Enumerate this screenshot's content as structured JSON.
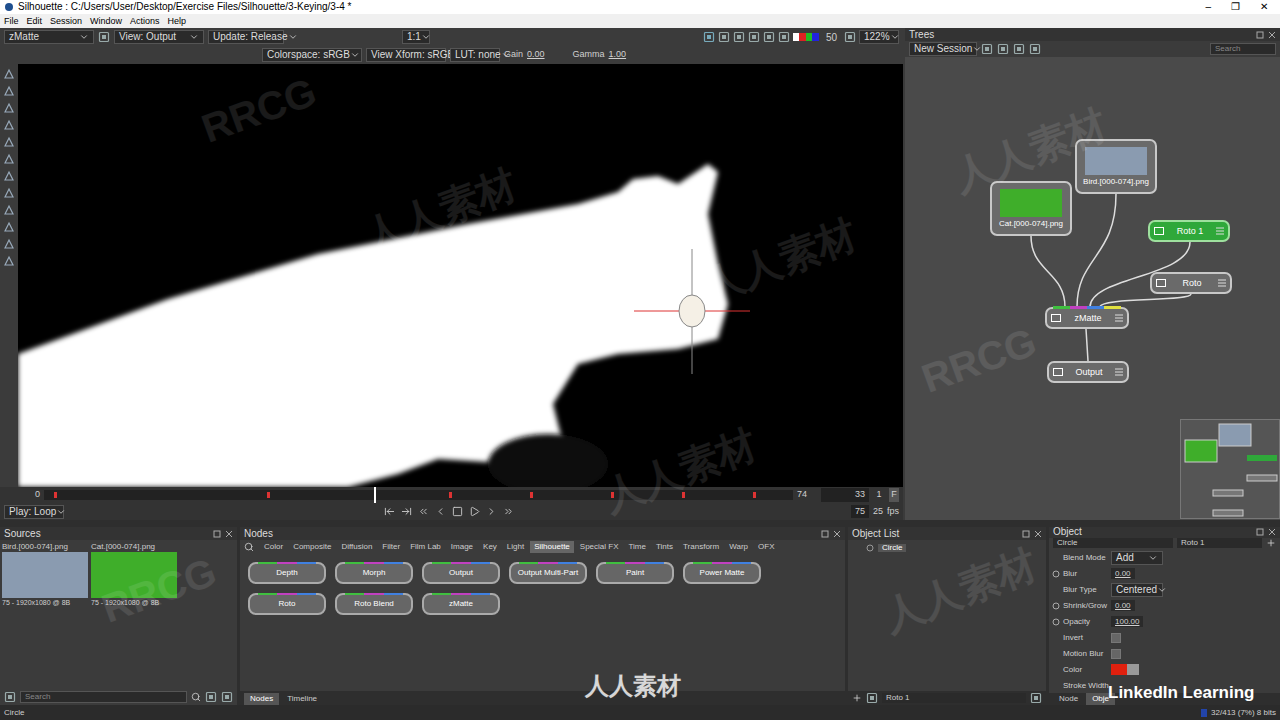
{
  "window": {
    "title": "Silhouette : C:/Users/User/Desktop/Exercise Files/Silhouette/3-Keying/3-4 *",
    "controls": [
      "–",
      "❐",
      "✕"
    ]
  },
  "menu": [
    "File",
    "Edit",
    "Session",
    "Window",
    "Actions",
    "Help"
  ],
  "viewer_toolbar": {
    "node": "zMatte",
    "view": "View: Output",
    "update": "Update: Release",
    "ratio": "1:1",
    "value": "50",
    "zoom": "122%",
    "colorspace": "Colorspace: sRGB",
    "view_xform": "View Xform: sRGB",
    "lut": "LUT: none",
    "gain_label": "Gain",
    "gain": "0.00",
    "gamma_label": "Gamma",
    "gamma": "1.00"
  },
  "timeline": {
    "start": "0",
    "end": "74",
    "current": "33",
    "step": "1",
    "mode": "F",
    "level": 0.44,
    "keyframes": [
      1,
      22,
      40,
      48,
      56,
      63,
      70
    ],
    "play_mode": "Play: Loop",
    "frames": "75",
    "fps": "25",
    "fps_label": "fps"
  },
  "trees": {
    "title": "Trees",
    "session": "New Session",
    "search_placeholder": "Search",
    "nodes": [
      {
        "label": "Cat.[000-074].png",
        "kind": "source",
        "selected": false,
        "color": "#3fae2a"
      },
      {
        "label": "Bird.[000-074].png",
        "kind": "source",
        "selected": false,
        "color": "#8a9bb0"
      },
      {
        "label": "Roto 1",
        "kind": "roto",
        "selected": true,
        "color": "#2fa83a"
      },
      {
        "label": "Roto",
        "kind": "roto",
        "selected": false,
        "color": "#6a6a6a"
      },
      {
        "label": "zMatte",
        "kind": "matte",
        "selected": false,
        "color": "#6a6a6a"
      },
      {
        "label": "Output",
        "kind": "output",
        "selected": false,
        "color": "#6a6a6a"
      }
    ]
  },
  "sources": {
    "title": "Sources",
    "items": [
      {
        "name": "Bird.[000-074].png",
        "info": "75 - 1920x1080 @ 8B",
        "color": "#8a9bb0"
      },
      {
        "name": "Cat.[000-074].png",
        "info": "75 - 1920x1080 @ 8B",
        "color": "#3fae2a"
      }
    ],
    "search_placeholder": "Search"
  },
  "nodes_panel": {
    "title": "Nodes",
    "tabs": [
      {
        "label": "Color",
        "selected": false
      },
      {
        "label": "Composite",
        "selected": false
      },
      {
        "label": "Diffusion",
        "selected": false
      },
      {
        "label": "Filter",
        "selected": false
      },
      {
        "label": "Film Lab",
        "selected": false
      },
      {
        "label": "Image",
        "selected": false
      },
      {
        "label": "Key",
        "selected": false
      },
      {
        "label": "Light",
        "selected": false
      },
      {
        "label": "Silhouette",
        "selected": true
      },
      {
        "label": "Special FX",
        "selected": false
      },
      {
        "label": "Time",
        "selected": false
      },
      {
        "label": "Tints",
        "selected": false
      },
      {
        "label": "Transform",
        "selected": false
      },
      {
        "label": "Warp",
        "selected": false
      },
      {
        "label": "OFX",
        "selected": false
      }
    ],
    "buttons": [
      "Depth",
      "Morph",
      "Output",
      "Output Multi-Part",
      "Paint",
      "Power Matte",
      "Roto",
      "Roto Blend",
      "zMatte"
    ],
    "bottom_tabs": [
      {
        "label": "Nodes",
        "selected": true
      },
      {
        "label": "Timeline",
        "selected": false
      }
    ]
  },
  "object_list": {
    "title": "Object List",
    "items": [
      {
        "name": "Circle",
        "selected": true
      }
    ],
    "footer": "Roto 1"
  },
  "object": {
    "title": "Object",
    "name": "Circle",
    "layer": "Roto 1",
    "properties": [
      {
        "label": "Blend Mode",
        "kind": "dropdown",
        "value": "Add",
        "keyframe_button": false
      },
      {
        "label": "Blur",
        "kind": "number",
        "value": "0.00",
        "keyframe_button": true
      },
      {
        "label": "Blur Type",
        "kind": "dropdown",
        "value": "Centered",
        "keyframe_button": false
      },
      {
        "label": "Shrink/Grow",
        "kind": "number",
        "value": "0.00",
        "keyframe_button": true
      },
      {
        "label": "Opacity",
        "kind": "number",
        "value": "100.00",
        "keyframe_button": true
      },
      {
        "label": "Invert",
        "kind": "checkbox",
        "checked": false,
        "keyframe_button": false
      },
      {
        "label": "Motion Blur",
        "kind": "checkbox",
        "checked": false,
        "keyframe_button": false
      },
      {
        "label": "Color",
        "kind": "color",
        "color": "#e0200e",
        "keyframe_button": false
      },
      {
        "label": "Stroke Width",
        "kind": "label",
        "keyframe_button": false
      }
    ],
    "bottom_tabs": [
      {
        "label": "Node",
        "selected": false
      },
      {
        "label": "Obje",
        "selected": true
      }
    ]
  },
  "status_bar": {
    "left": "Circle",
    "right": "32/413 (7%) 8 bits"
  },
  "watermarks": [
    "RRCG",
    "人人素材"
  ],
  "brand_logo": "人人素材",
  "linkedin_logo": "LinkedIn Learning"
}
